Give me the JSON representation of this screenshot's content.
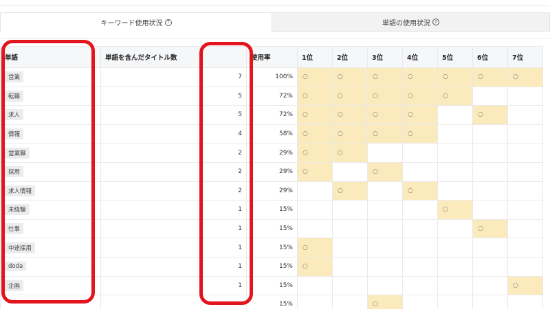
{
  "tabs": [
    {
      "label": "キーワード使用状況",
      "help": "?"
    },
    {
      "label": "単語の使用状況",
      "help": "?"
    }
  ],
  "table": {
    "headers": {
      "word": "単語",
      "title_count": "単語を含んだタイトル数",
      "count": "",
      "rate": "使用率",
      "ranks": [
        "1位",
        "2位",
        "3位",
        "4位",
        "5位",
        "6位",
        "7位"
      ]
    },
    "mark": "○",
    "rows": [
      {
        "word": "営業",
        "count": "7",
        "rate": "100%",
        "ranks": [
          1,
          1,
          1,
          1,
          1,
          1,
          1
        ]
      },
      {
        "word": "転職",
        "count": "5",
        "rate": "72%",
        "ranks": [
          1,
          1,
          1,
          1,
          1,
          0,
          0
        ]
      },
      {
        "word": "求人",
        "count": "5",
        "rate": "72%",
        "ranks": [
          1,
          1,
          1,
          1,
          0,
          1,
          0
        ]
      },
      {
        "word": "情報",
        "count": "4",
        "rate": "58%",
        "ranks": [
          1,
          1,
          1,
          1,
          0,
          0,
          0
        ]
      },
      {
        "word": "営業職",
        "count": "2",
        "rate": "29%",
        "ranks": [
          1,
          1,
          0,
          0,
          0,
          0,
          0
        ]
      },
      {
        "word": "採用",
        "count": "2",
        "rate": "29%",
        "ranks": [
          1,
          0,
          1,
          0,
          0,
          0,
          0
        ]
      },
      {
        "word": "求人情報",
        "count": "2",
        "rate": "29%",
        "ranks": [
          0,
          1,
          0,
          1,
          0,
          0,
          0
        ]
      },
      {
        "word": "未経験",
        "count": "1",
        "rate": "15%",
        "ranks": [
          0,
          0,
          0,
          0,
          1,
          0,
          0
        ]
      },
      {
        "word": "仕事",
        "count": "1",
        "rate": "15%",
        "ranks": [
          0,
          0,
          0,
          0,
          0,
          1,
          0
        ]
      },
      {
        "word": "中途採用",
        "count": "1",
        "rate": "15%",
        "ranks": [
          1,
          0,
          0,
          0,
          0,
          0,
          0
        ]
      },
      {
        "word": "doda",
        "count": "1",
        "rate": "15%",
        "ranks": [
          1,
          0,
          0,
          0,
          0,
          0,
          0
        ]
      },
      {
        "word": "企画",
        "count": "1",
        "rate": "15%",
        "ranks": [
          0,
          0,
          0,
          0,
          0,
          0,
          1
        ]
      },
      {
        "word": "",
        "count": "",
        "rate": "15%",
        "ranks": [
          0,
          0,
          1,
          0,
          0,
          0,
          0
        ]
      }
    ]
  },
  "colors": {
    "highlight": "#e3141d",
    "used_cell": "#fbeabb"
  }
}
